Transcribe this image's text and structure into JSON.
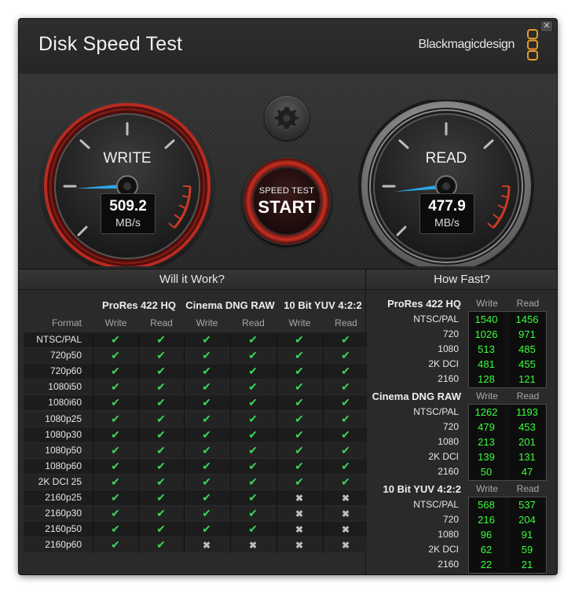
{
  "window": {
    "title": "Disk Speed Test",
    "brand": "Blackmagicdesign",
    "close_glyph": "✕"
  },
  "gauges": {
    "write": {
      "label": "WRITE",
      "value": "509.2",
      "unit": "MB/s"
    },
    "read": {
      "label": "READ",
      "value": "477.9",
      "unit": "MB/s"
    }
  },
  "controls": {
    "settings_icon": "gear-icon",
    "start_small": "SPEED TEST",
    "start_big": "START"
  },
  "will_it_work": {
    "header": "Will it Work?",
    "format_label": "Format",
    "groups": [
      "ProRes 422 HQ",
      "Cinema DNG RAW",
      "10 Bit YUV 4:2:2"
    ],
    "sub": [
      "Write",
      "Read"
    ],
    "rows": [
      {
        "format": "NTSC/PAL",
        "vals": [
          1,
          1,
          1,
          1,
          1,
          1
        ]
      },
      {
        "format": "720p50",
        "vals": [
          1,
          1,
          1,
          1,
          1,
          1
        ]
      },
      {
        "format": "720p60",
        "vals": [
          1,
          1,
          1,
          1,
          1,
          1
        ]
      },
      {
        "format": "1080i50",
        "vals": [
          1,
          1,
          1,
          1,
          1,
          1
        ]
      },
      {
        "format": "1080i60",
        "vals": [
          1,
          1,
          1,
          1,
          1,
          1
        ]
      },
      {
        "format": "1080p25",
        "vals": [
          1,
          1,
          1,
          1,
          1,
          1
        ]
      },
      {
        "format": "1080p30",
        "vals": [
          1,
          1,
          1,
          1,
          1,
          1
        ]
      },
      {
        "format": "1080p50",
        "vals": [
          1,
          1,
          1,
          1,
          1,
          1
        ]
      },
      {
        "format": "1080p60",
        "vals": [
          1,
          1,
          1,
          1,
          1,
          1
        ]
      },
      {
        "format": "2K DCI 25",
        "vals": [
          1,
          1,
          1,
          1,
          1,
          1
        ]
      },
      {
        "format": "2160p25",
        "vals": [
          1,
          1,
          1,
          1,
          0,
          0
        ]
      },
      {
        "format": "2160p30",
        "vals": [
          1,
          1,
          1,
          1,
          0,
          0
        ]
      },
      {
        "format": "2160p50",
        "vals": [
          1,
          1,
          1,
          1,
          0,
          0
        ]
      },
      {
        "format": "2160p60",
        "vals": [
          1,
          1,
          0,
          0,
          0,
          0
        ]
      }
    ],
    "check_glyph": "✔",
    "cross_glyph": "✖",
    "check_color": "#3cd45a",
    "cross_color": "#bdbdbd"
  },
  "how_fast": {
    "header": "How Fast?",
    "sub": [
      "Write",
      "Read"
    ],
    "value_color": "#39ff3c",
    "groups": [
      {
        "name": "ProRes 422 HQ",
        "rows": [
          {
            "format": "NTSC/PAL",
            "write": "1540",
            "read": "1456"
          },
          {
            "format": "720",
            "write": "1026",
            "read": "971"
          },
          {
            "format": "1080",
            "write": "513",
            "read": "485"
          },
          {
            "format": "2K DCI",
            "write": "481",
            "read": "455"
          },
          {
            "format": "2160",
            "write": "128",
            "read": "121"
          }
        ]
      },
      {
        "name": "Cinema DNG RAW",
        "rows": [
          {
            "format": "NTSC/PAL",
            "write": "1262",
            "read": "1193"
          },
          {
            "format": "720",
            "write": "479",
            "read": "453"
          },
          {
            "format": "1080",
            "write": "213",
            "read": "201"
          },
          {
            "format": "2K DCI",
            "write": "139",
            "read": "131"
          },
          {
            "format": "2160",
            "write": "50",
            "read": "47"
          }
        ]
      },
      {
        "name": "10 Bit YUV 4:2:2",
        "rows": [
          {
            "format": "NTSC/PAL",
            "write": "568",
            "read": "537"
          },
          {
            "format": "720",
            "write": "216",
            "read": "204"
          },
          {
            "format": "1080",
            "write": "96",
            "read": "91"
          },
          {
            "format": "2K DCI",
            "write": "62",
            "read": "59"
          },
          {
            "format": "2160",
            "write": "22",
            "read": "21"
          }
        ]
      }
    ]
  }
}
